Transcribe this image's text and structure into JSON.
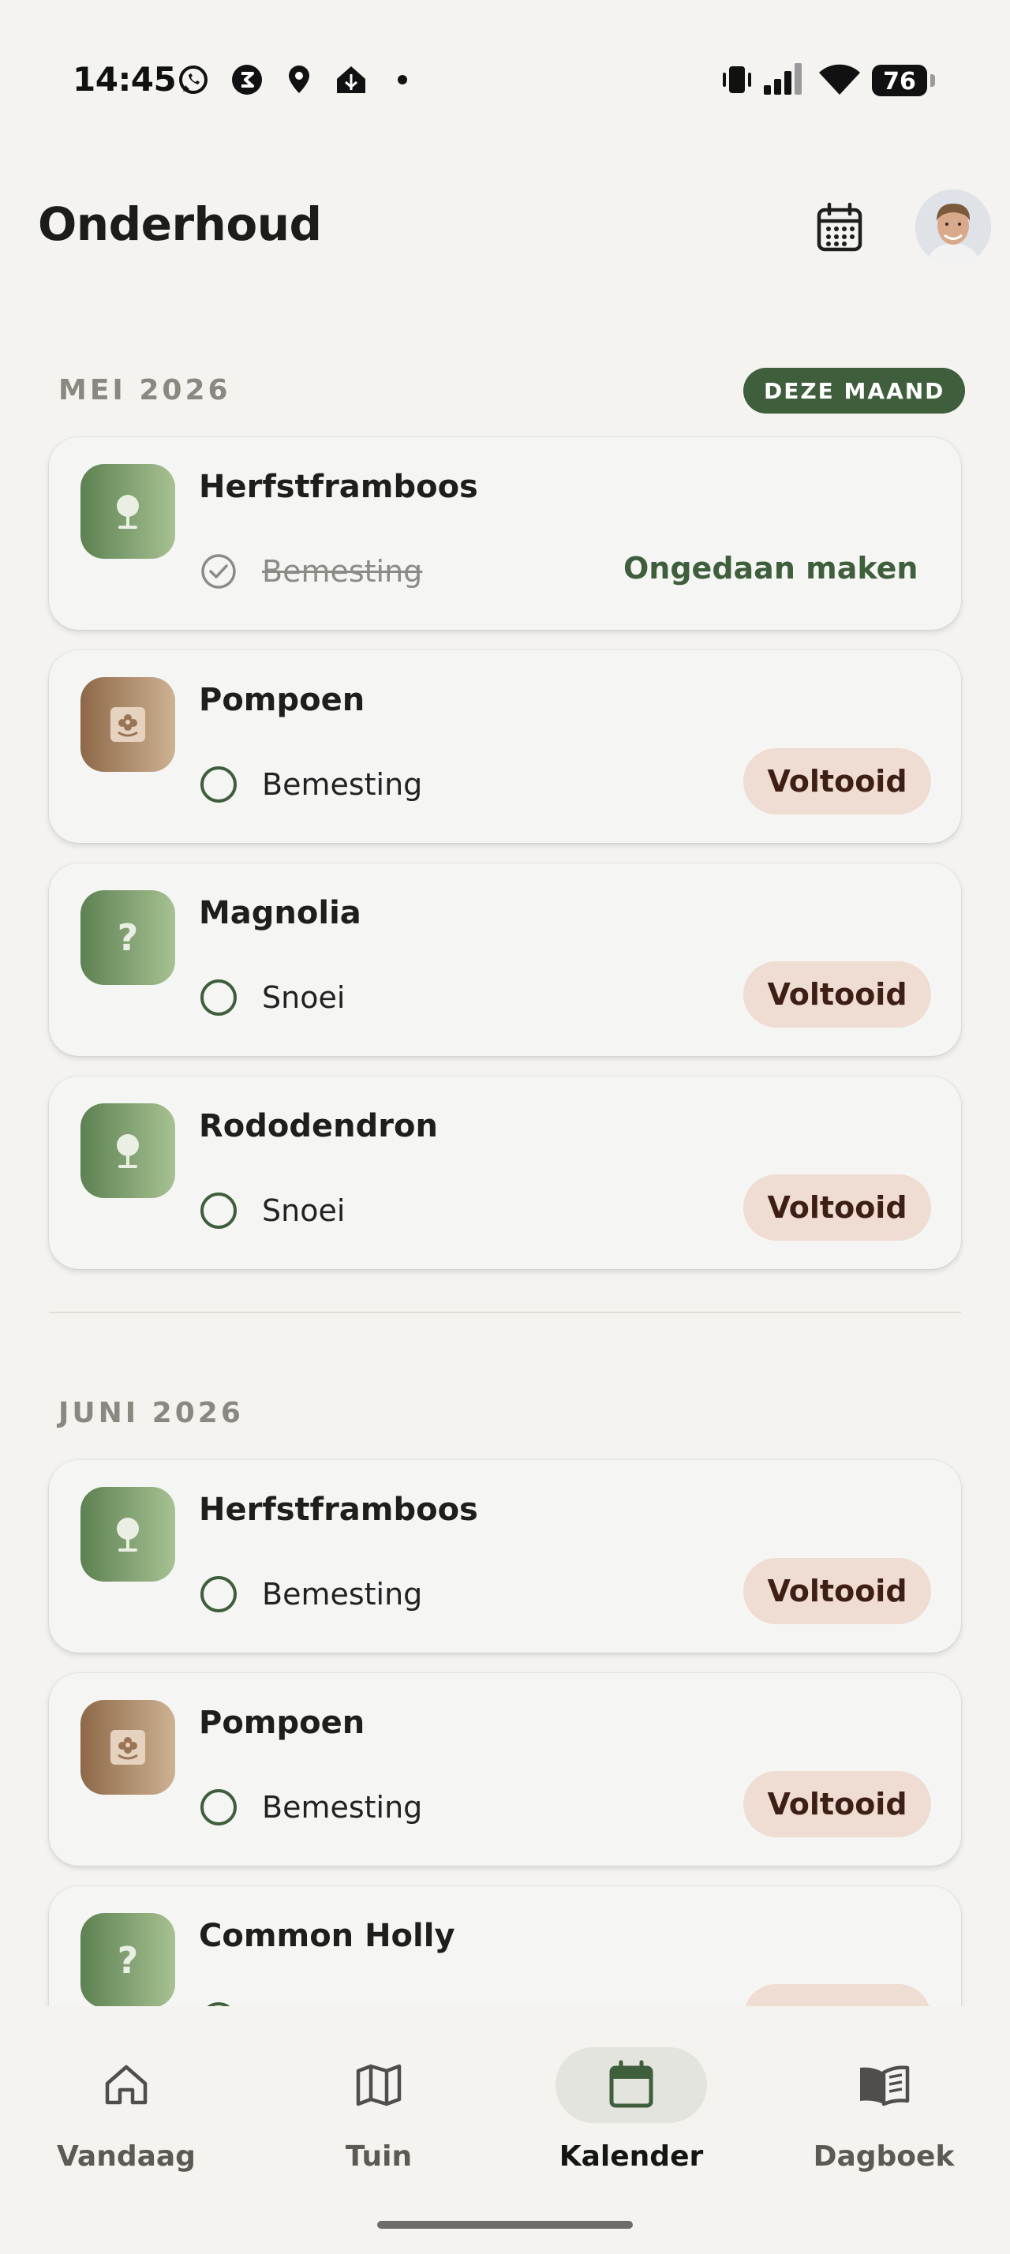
{
  "status_bar": {
    "time": "14:45",
    "battery": "76",
    "left_icons": [
      "whatsapp-icon",
      "app-s-icon",
      "location-pin-icon",
      "home-assistant-icon",
      "dot-icon"
    ],
    "right_icons": [
      "vibrate-icon",
      "signal-icon",
      "wifi-icon"
    ]
  },
  "header": {
    "title": "Onderhoud"
  },
  "colors": {
    "accent": "#3f5e3c",
    "voltooid_bg": "#efdcd2",
    "voltooid_text": "#3e1f15",
    "background": "#f4f3ef"
  },
  "sections": [
    {
      "month": "MEI 2026",
      "badge": "DEZE MAAND",
      "items": [
        {
          "name": "Herfstframboos",
          "task": "Bemesting",
          "done": true,
          "thumb": "tree-icon",
          "thumb_color": "green",
          "action": "Ongedaan maken"
        },
        {
          "name": "Pompoen",
          "task": "Bemesting",
          "done": false,
          "thumb": "flower-icon",
          "thumb_color": "brown",
          "action": "Voltooid"
        },
        {
          "name": "Magnolia",
          "task": "Snoei",
          "done": false,
          "thumb": "question-icon",
          "thumb_color": "green",
          "action": "Voltooid"
        },
        {
          "name": "Rododendron",
          "task": "Snoei",
          "done": false,
          "thumb": "tree-icon",
          "thumb_color": "green",
          "action": "Voltooid"
        }
      ]
    },
    {
      "month": "JUNI 2026",
      "badge": "",
      "items": [
        {
          "name": "Herfstframboos",
          "task": "Bemesting",
          "done": false,
          "thumb": "tree-icon",
          "thumb_color": "green",
          "action": "Voltooid"
        },
        {
          "name": "Pompoen",
          "task": "Bemesting",
          "done": false,
          "thumb": "flower-icon",
          "thumb_color": "brown",
          "action": "Voltooid"
        },
        {
          "name": "Common Holly",
          "task": "",
          "done": false,
          "thumb": "question-icon",
          "thumb_color": "green",
          "action": ""
        }
      ]
    }
  ],
  "nav": [
    {
      "label": "Vandaag",
      "icon": "home-icon",
      "active": false
    },
    {
      "label": "Tuin",
      "icon": "map-icon",
      "active": false
    },
    {
      "label": "Kalender",
      "icon": "calendar-icon",
      "active": true
    },
    {
      "label": "Dagboek",
      "icon": "book-icon",
      "active": false
    }
  ]
}
